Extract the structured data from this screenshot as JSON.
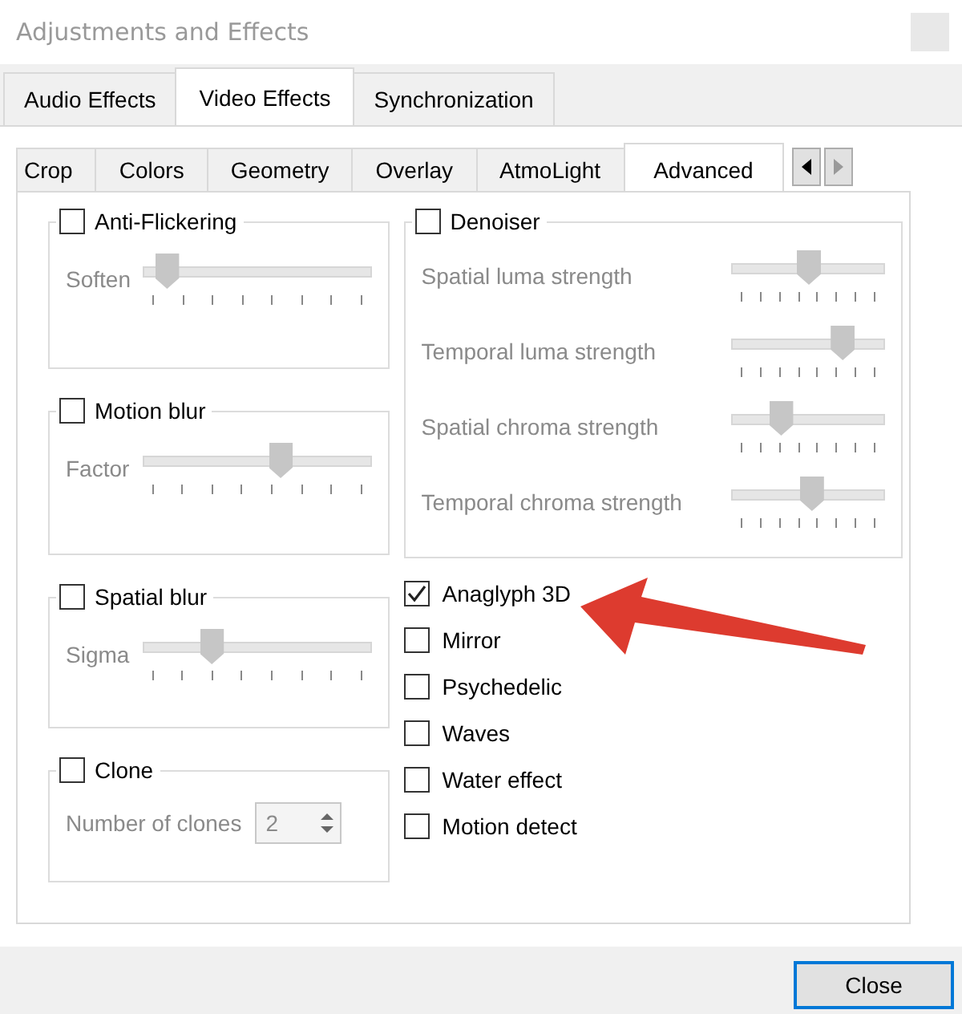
{
  "window": {
    "title": "Adjustments and Effects"
  },
  "tabs": [
    {
      "label": "Audio Effects",
      "selected": false
    },
    {
      "label": "Video Effects",
      "selected": true
    },
    {
      "label": "Synchronization",
      "selected": false
    }
  ],
  "subtabs": [
    {
      "label": "Crop",
      "selected": false
    },
    {
      "label": "Colors",
      "selected": false
    },
    {
      "label": "Geometry",
      "selected": false
    },
    {
      "label": "Overlay",
      "selected": false
    },
    {
      "label": "AtmoLight",
      "selected": false
    },
    {
      "label": "Advanced",
      "selected": true
    }
  ],
  "left_groups": [
    {
      "kind": "slider",
      "title": "Anti-Flickering",
      "checked": false,
      "control": {
        "label": "Soften",
        "level": 0.1,
        "disabled": true
      }
    },
    {
      "kind": "slider",
      "title": "Motion blur",
      "checked": false,
      "control": {
        "label": "Factor",
        "level": 0.6,
        "disabled": true
      }
    },
    {
      "kind": "slider",
      "title": "Spatial blur",
      "checked": false,
      "control": {
        "label": "Sigma",
        "level": 0.3,
        "disabled": true
      }
    },
    {
      "kind": "spinbox",
      "title": "Clone",
      "checked": false,
      "control": {
        "label": "Number of clones",
        "value": "2",
        "disabled": true
      }
    }
  ],
  "denoiser": {
    "title": "Denoiser",
    "checked": false,
    "sliders": [
      {
        "label": "Spatial luma strength",
        "level": 0.5,
        "disabled": true
      },
      {
        "label": "Temporal luma strength",
        "level": 0.72,
        "disabled": true
      },
      {
        "label": "Spatial chroma strength",
        "level": 0.32,
        "disabled": true
      },
      {
        "label": "Temporal chroma strength",
        "level": 0.52,
        "disabled": true
      }
    ]
  },
  "filters": [
    {
      "label": "Anaglyph 3D",
      "checked": true
    },
    {
      "label": "Mirror",
      "checked": false
    },
    {
      "label": "Psychedelic",
      "checked": false
    },
    {
      "label": "Waves",
      "checked": false
    },
    {
      "label": "Water effect",
      "checked": false
    },
    {
      "label": "Motion detect",
      "checked": false
    }
  ],
  "buttons": [
    {
      "label": "Close"
    }
  ]
}
